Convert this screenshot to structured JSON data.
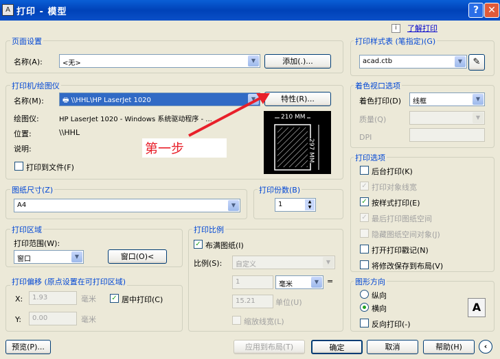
{
  "window": {
    "title": "打印 - 模型",
    "icon_text": "A",
    "help_btn": "?",
    "close_btn": "✕"
  },
  "help_link": "了解打印",
  "page_setup": {
    "legend": "页面设置",
    "name_label": "名称(A):",
    "name_value": "<无>",
    "add_btn": "添加(.)..."
  },
  "printer": {
    "legend": "打印机/绘图仪",
    "name_label": "名称(M):",
    "name_value": "\\\\HHL\\HP LaserJet 1020",
    "props_btn": "特性(R)...",
    "plotter_label": "绘图仪:",
    "plotter_value": "HP LaserJet 1020 - Windows 系统驱动程序 - ...",
    "location_label": "位置:",
    "location_value": "\\\\HHL",
    "desc_label": "说明:",
    "print_to_file": "打印到文件(F)",
    "preview_width": "210 MM",
    "preview_height": "297 MM"
  },
  "annotation": "第一步",
  "paper": {
    "legend": "图纸尺寸(Z)",
    "value": "A4"
  },
  "copies": {
    "legend": "打印份数(B)",
    "value": "1"
  },
  "area": {
    "legend": "打印区域",
    "range_label": "打印范围(W):",
    "range_value": "窗口",
    "window_btn": "窗口(O)<"
  },
  "offset": {
    "legend": "打印偏移 (原点设置在可打印区域)",
    "x_label": "X:",
    "x_value": "1.93",
    "x_unit": "毫米",
    "y_label": "Y:",
    "y_value": "0.00",
    "y_unit": "毫米",
    "center": "居中打印(C)"
  },
  "scale": {
    "legend": "打印比例",
    "fit": "布满图纸(I)",
    "scale_label": "比例(S):",
    "scale_value": "自定义",
    "v1": "1",
    "unit": "毫米",
    "eq": "=",
    "v2": "15.21",
    "v2_unit": "单位(U)",
    "lineweights": "缩放线宽(L)"
  },
  "style_table": {
    "legend": "打印样式表 (笔指定)(G)",
    "value": "acad.ctb"
  },
  "shaded": {
    "legend": "着色视口选项",
    "shade_label": "着色打印(D)",
    "shade_value": "线框",
    "quality_label": "质量(Q)",
    "dpi_label": "DPI"
  },
  "options": {
    "legend": "打印选项",
    "items": [
      {
        "label": "后台打印(K)",
        "checked": false,
        "enabled": true
      },
      {
        "label": "打印对象线宽",
        "checked": true,
        "enabled": false
      },
      {
        "label": "按样式打印(E)",
        "checked": true,
        "enabled": true
      },
      {
        "label": "最后打印图纸空间",
        "checked": true,
        "enabled": false
      },
      {
        "label": "隐藏图纸空间对象(J)",
        "checked": false,
        "enabled": false
      },
      {
        "label": "打开打印戳记(N)",
        "checked": false,
        "enabled": true
      },
      {
        "label": "将修改保存到布局(V)",
        "checked": false,
        "enabled": true
      }
    ]
  },
  "orientation": {
    "legend": "图形方向",
    "portrait": "纵向",
    "landscape": "横向",
    "reverse": "反向打印(-)",
    "selected": "landscape"
  },
  "footer": {
    "preview": "预览(P)...",
    "apply": "应用到布局(T)",
    "ok": "确定",
    "cancel": "取消",
    "help": "帮助(H)"
  },
  "colors": {
    "accent": "#0046d5",
    "annotation": "#e8202a"
  }
}
